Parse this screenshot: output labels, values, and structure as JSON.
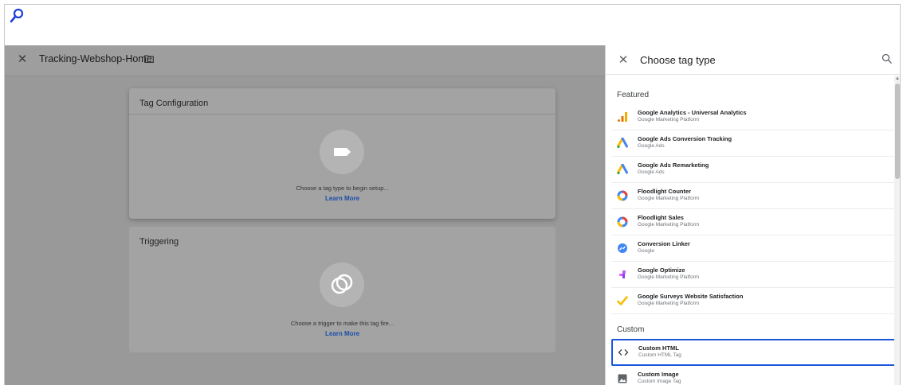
{
  "workspace": {
    "tag_name": "Tracking-Webshop-Home",
    "tag_configuration": {
      "title": "Tag Configuration",
      "hint": "Choose a tag type to begin setup...",
      "link": "Learn More"
    },
    "triggering": {
      "title": "Triggering",
      "hint": "Choose a trigger to make this tag fire...",
      "link": "Learn More"
    }
  },
  "panel": {
    "title": "Choose tag type",
    "featured_label": "Featured",
    "custom_label": "Custom",
    "featured": [
      {
        "name": "Google Analytics - Universal Analytics",
        "sub": "Google Marketing Platform",
        "icon": "google-analytics-icon"
      },
      {
        "name": "Google Ads Conversion Tracking",
        "sub": "Google Ads",
        "icon": "google-ads-icon"
      },
      {
        "name": "Google Ads Remarketing",
        "sub": "Google Ads",
        "icon": "google-ads-icon"
      },
      {
        "name": "Floodlight Counter",
        "sub": "Google Marketing Platform",
        "icon": "floodlight-icon"
      },
      {
        "name": "Floodlight Sales",
        "sub": "Google Marketing Platform",
        "icon": "floodlight-icon"
      },
      {
        "name": "Conversion Linker",
        "sub": "Google",
        "icon": "conversion-linker-icon"
      },
      {
        "name": "Google Optimize",
        "sub": "Google Marketing Platform",
        "icon": "google-optimize-icon"
      },
      {
        "name": "Google Surveys Website Satisfaction",
        "sub": "Google Marketing Platform",
        "icon": "google-surveys-icon"
      }
    ],
    "custom": [
      {
        "name": "Custom HTML",
        "sub": "Custom HTML Tag",
        "icon": "code-icon",
        "selected": true
      },
      {
        "name": "Custom Image",
        "sub": "Custom Image Tag",
        "icon": "image-icon"
      }
    ]
  },
  "colors": {
    "selection_border": "#1a56db",
    "link": "#1a4ea8",
    "overlay": "#999999"
  }
}
